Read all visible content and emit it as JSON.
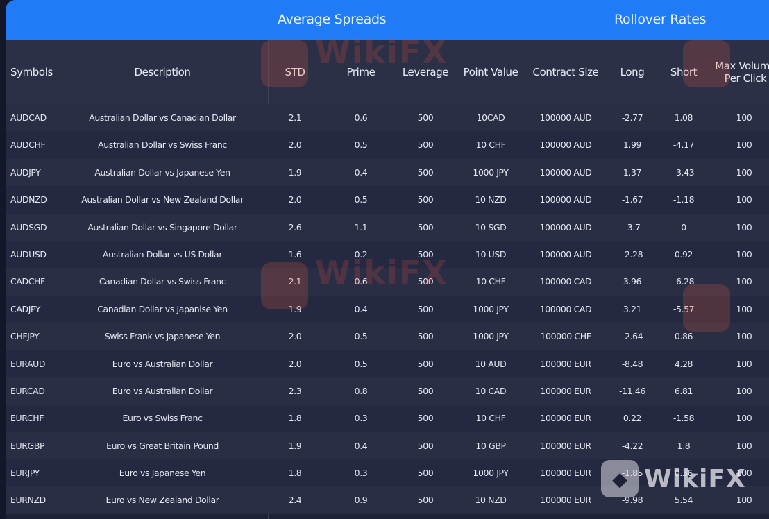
{
  "header_groups": {
    "spreads": "Average Spreads",
    "rollover": "Rollover Rates"
  },
  "columns": [
    "Symbols",
    "Description",
    "STD",
    "Prime",
    "Leverage",
    "Point Value",
    "Contract Size",
    "Long",
    "Short",
    "Max Volume Per Click"
  ],
  "rows": [
    [
      "AUDCAD",
      "Australian Dollar vs Canadian Dollar",
      "2.1",
      "0.6",
      "500",
      "10CAD",
      "100000 AUD",
      "-2.77",
      "1.08",
      "100"
    ],
    [
      "AUDCHF",
      "Australian Dollar vs Swiss Franc",
      "2.0",
      "0.5",
      "500",
      "10 CHF",
      "100000 AUD",
      "1.99",
      "-4.17",
      "100"
    ],
    [
      "AUDJPY",
      "Australian Dollar vs Japanese Yen",
      "1.9",
      "0.4",
      "500",
      "1000 JPY",
      "100000 AUD",
      "1.37",
      "-3.43",
      "100"
    ],
    [
      "AUDNZD",
      "Australian Dollar vs New Zealand Dollar",
      "2.0",
      "0.5",
      "500",
      "10 NZD",
      "100000 AUD",
      "-1.67",
      "-1.18",
      "100"
    ],
    [
      "AUDSGD",
      "Australian Dollar vs Singapore Dollar",
      "2.6",
      "1.1",
      "500",
      "10 SGD",
      "100000 AUD",
      "-3.7",
      "0",
      "100"
    ],
    [
      "AUDUSD",
      "Australian Dollar vs US Dollar",
      "1.6",
      "0.2",
      "500",
      "10 USD",
      "100000 AUD",
      "-2.28",
      "0.92",
      "100"
    ],
    [
      "CADCHF",
      "Canadian Dollar vs Swiss Franc",
      "2.1",
      "0.6",
      "500",
      "10 CHF",
      "100000 CAD",
      "3.96",
      "-6.28",
      "100"
    ],
    [
      "CADJPY",
      "Canadian Dollar vs Japanise Yen",
      "1.9",
      "0.4",
      "500",
      "1000 JPY",
      "100000 CAD",
      "3.21",
      "-5.57",
      "100"
    ],
    [
      "CHFJPY",
      "Swiss Frank vs Japanese Yen",
      "2.0",
      "0.5",
      "500",
      "1000 JPY",
      "100000 CHF",
      "-2.64",
      "0.86",
      "100"
    ],
    [
      "EURAUD",
      "Euro vs Australian Dollar",
      "2.0",
      "0.5",
      "500",
      "10 AUD",
      "100000 EUR",
      "-8.48",
      "4.28",
      "100"
    ],
    [
      "EURCAD",
      "Euro vs Australian Dollar",
      "2.3",
      "0.8",
      "500",
      "10 CAD",
      "100000 EUR",
      "-11.46",
      "6.81",
      "100"
    ],
    [
      "EURCHF",
      "Euro vs Swiss Franc",
      "1.8",
      "0.3",
      "500",
      "10 CHF",
      "100000 EUR",
      "0.22",
      "-1.58",
      "100"
    ],
    [
      "EURGBP",
      "Euro vs Great Britain Pound",
      "1.9",
      "0.4",
      "500",
      "10 GBP",
      "100000 EUR",
      "-4.22",
      "1.8",
      "100"
    ],
    [
      "EURJPY",
      "Euro vs Japanese Yen",
      "1.8",
      "0.3",
      "500",
      "1000 JPY",
      "100000 EUR",
      "-1.85",
      "0.36",
      "100"
    ],
    [
      "EURNZD",
      "Euro vs New Zealand Dollar",
      "2.4",
      "0.9",
      "500",
      "10 NZD",
      "100000 EUR",
      "-9.98",
      "5.54",
      "100"
    ]
  ],
  "watermark": {
    "text": "WikiFX"
  },
  "colors": {
    "group_header_bg": "#1f7cf6",
    "column_header_bg": "#2b3047",
    "row_bg_a": "#2a2e45",
    "row_bg_b": "#242841",
    "page_bg": "#14172a"
  }
}
